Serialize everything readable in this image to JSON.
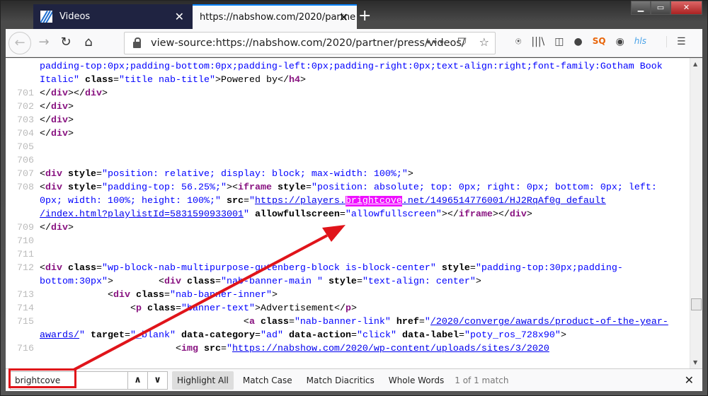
{
  "tabs": [
    {
      "title": "Videos",
      "close": "✕"
    },
    {
      "title": "https://nabshow.com/2020/partne",
      "close": "✕"
    }
  ],
  "new_tab": "+",
  "window": {
    "minimize": "▁",
    "maximize": "▭",
    "close": "✕"
  },
  "nav": {
    "back": "←",
    "forward": "→",
    "reload": "↻",
    "home": "⌂",
    "url": "view-source:https://nabshow.com/2020/partner/press/videos/",
    "more": "•••",
    "pocket": "⛉",
    "bookmark": "☆"
  },
  "toolbar_icons": [
    "bookmark-toolbar-icon",
    "library-icon",
    "sidebar-icon",
    "extension-icon",
    "sq-extension-icon",
    "account-icon",
    "hls-extension-icon",
    "menu-icon"
  ],
  "toolbar_glyphs": [
    "⍟",
    "|||\\",
    "◫",
    "●",
    "SQ",
    "◉",
    "hls",
    "☰"
  ],
  "code": [
    {
      "n": "",
      "tokens": [
        [
          "v",
          "padding-top:0px;padding-bottom:0px;padding-left:0px;padding-right:0px;text-align:right;font-family:Gotham Book"
        ]
      ]
    },
    {
      "n": "",
      "tokens": [
        [
          "v",
          "Italic\""
        ],
        [
          "x",
          " "
        ],
        [
          "a",
          "class"
        ],
        [
          "x",
          "="
        ],
        [
          "v",
          "\"title nab-title\""
        ],
        [
          "x",
          ">Powered by</"
        ],
        [
          "t",
          "h4"
        ],
        [
          "x",
          ">"
        ]
      ]
    },
    {
      "n": "701",
      "tokens": [
        [
          "x",
          "</"
        ],
        [
          "t",
          "div"
        ],
        [
          "x",
          "></"
        ],
        [
          "t",
          "div"
        ],
        [
          "x",
          ">"
        ]
      ]
    },
    {
      "n": "702",
      "tokens": [
        [
          "x",
          "</"
        ],
        [
          "t",
          "div"
        ],
        [
          "x",
          ">"
        ]
      ]
    },
    {
      "n": "703",
      "tokens": [
        [
          "x",
          "</"
        ],
        [
          "t",
          "div"
        ],
        [
          "x",
          ">"
        ]
      ]
    },
    {
      "n": "704",
      "tokens": [
        [
          "x",
          "</"
        ],
        [
          "t",
          "div"
        ],
        [
          "x",
          ">"
        ]
      ]
    },
    {
      "n": "705",
      "tokens": []
    },
    {
      "n": "706",
      "tokens": []
    },
    {
      "n": "707",
      "tokens": [
        [
          "x",
          "<"
        ],
        [
          "t",
          "div"
        ],
        [
          "x",
          " "
        ],
        [
          "a",
          "style"
        ],
        [
          "x",
          "="
        ],
        [
          "v",
          "\"position: relative; display: block; max-width: 100%;\""
        ],
        [
          "x",
          ">"
        ]
      ]
    },
    {
      "n": "708",
      "tokens": [
        [
          "x",
          "<"
        ],
        [
          "t",
          "div"
        ],
        [
          "x",
          " "
        ],
        [
          "a",
          "style"
        ],
        [
          "x",
          "="
        ],
        [
          "v",
          "\"padding-top: 56.25%;\""
        ],
        [
          "x",
          "><"
        ],
        [
          "t",
          "iframe"
        ],
        [
          "x",
          " "
        ],
        [
          "a",
          "style"
        ],
        [
          "x",
          "="
        ],
        [
          "v",
          "\"position: absolute; top: 0px; right: 0px; bottom: 0px; left:"
        ]
      ]
    },
    {
      "n": "",
      "tokens": [
        [
          "v",
          "0px; width: 100%; height: 100%;\""
        ],
        [
          "x",
          " "
        ],
        [
          "a",
          "src"
        ],
        [
          "x",
          "="
        ],
        [
          "v",
          "\""
        ],
        [
          "u",
          "https://players."
        ],
        [
          "h",
          "brightcove"
        ],
        [
          "u",
          ".net/1496514776001/HJ2RqAf0g_default"
        ]
      ]
    },
    {
      "n": "",
      "tokens": [
        [
          "u",
          "/index.html?playlistId=5831590933001"
        ],
        [
          "v",
          "\""
        ],
        [
          "x",
          " "
        ],
        [
          "a",
          "allowfullscreen"
        ],
        [
          "x",
          "="
        ],
        [
          "v",
          "\"allowfullscreen\""
        ],
        [
          "x",
          "></"
        ],
        [
          "t",
          "iframe"
        ],
        [
          "x",
          "></"
        ],
        [
          "t",
          "div"
        ],
        [
          "x",
          ">"
        ]
      ]
    },
    {
      "n": "709",
      "tokens": [
        [
          "x",
          "</"
        ],
        [
          "t",
          "div"
        ],
        [
          "x",
          ">"
        ]
      ]
    },
    {
      "n": "710",
      "tokens": []
    },
    {
      "n": "711",
      "tokens": []
    },
    {
      "n": "712",
      "tokens": [
        [
          "x",
          "<"
        ],
        [
          "t",
          "div"
        ],
        [
          "x",
          " "
        ],
        [
          "a",
          "class"
        ],
        [
          "x",
          "="
        ],
        [
          "v",
          "\"wp-block-nab-multipurpose-gutenberg-block is-block-center\""
        ],
        [
          "x",
          " "
        ],
        [
          "a",
          "style"
        ],
        [
          "x",
          "="
        ],
        [
          "v",
          "\"padding-top:30px;padding-"
        ]
      ]
    },
    {
      "n": "",
      "tokens": [
        [
          "v",
          "bottom:30px\""
        ],
        [
          "x",
          ">        <"
        ],
        [
          "t",
          "div"
        ],
        [
          "x",
          " "
        ],
        [
          "a",
          "class"
        ],
        [
          "x",
          "="
        ],
        [
          "v",
          "\"nab-banner-main \""
        ],
        [
          "x",
          " "
        ],
        [
          "a",
          "style"
        ],
        [
          "x",
          "="
        ],
        [
          "v",
          "\"text-align: center\""
        ],
        [
          "x",
          ">"
        ]
      ]
    },
    {
      "n": "713",
      "tokens": [
        [
          "x",
          "            <"
        ],
        [
          "t",
          "div"
        ],
        [
          "x",
          " "
        ],
        [
          "a",
          "class"
        ],
        [
          "x",
          "="
        ],
        [
          "v",
          "\"nab-banner-inner\""
        ],
        [
          "x",
          ">"
        ]
      ]
    },
    {
      "n": "714",
      "tokens": [
        [
          "x",
          "                <"
        ],
        [
          "t",
          "p"
        ],
        [
          "x",
          " "
        ],
        [
          "a",
          "class"
        ],
        [
          "x",
          "="
        ],
        [
          "v",
          "\"banner-text\""
        ],
        [
          "x",
          ">Advertisement</"
        ],
        [
          "t",
          "p"
        ],
        [
          "x",
          ">"
        ]
      ]
    },
    {
      "n": "715",
      "tokens": [
        [
          "x",
          "                                    <"
        ],
        [
          "t",
          "a"
        ],
        [
          "x",
          " "
        ],
        [
          "a",
          "class"
        ],
        [
          "x",
          "="
        ],
        [
          "v",
          "\"nab-banner-link\""
        ],
        [
          "x",
          " "
        ],
        [
          "a",
          "href"
        ],
        [
          "x",
          "="
        ],
        [
          "v",
          "\""
        ],
        [
          "u",
          "/2020/converge/awards/product-of-the-year-"
        ]
      ]
    },
    {
      "n": "",
      "tokens": [
        [
          "u",
          "awards/"
        ],
        [
          "v",
          "\""
        ],
        [
          "x",
          " "
        ],
        [
          "a",
          "target"
        ],
        [
          "x",
          "="
        ],
        [
          "v",
          "\"_blank\""
        ],
        [
          "x",
          " "
        ],
        [
          "a",
          "data-category"
        ],
        [
          "x",
          "="
        ],
        [
          "v",
          "\"ad\""
        ],
        [
          "x",
          " "
        ],
        [
          "a",
          "data-action"
        ],
        [
          "x",
          "="
        ],
        [
          "v",
          "\"click\""
        ],
        [
          "x",
          " "
        ],
        [
          "a",
          "data-label"
        ],
        [
          "x",
          "="
        ],
        [
          "v",
          "\"poty_ros_728x90\""
        ],
        [
          "x",
          ">"
        ]
      ]
    },
    {
      "n": "716",
      "tokens": [
        [
          "x",
          "                        <"
        ],
        [
          "t",
          "img"
        ],
        [
          "x",
          " "
        ],
        [
          "a",
          "src"
        ],
        [
          "x",
          "="
        ],
        [
          "v",
          "\""
        ],
        [
          "u",
          "https://nabshow.com/2020/wp-content/uploads/sites/3/2020"
        ]
      ]
    }
  ],
  "find": {
    "query": "brightcove",
    "prev": "∧",
    "next": "∨",
    "highlight_all": "Highlight All",
    "match_case": "Match Case",
    "match_diacritics": "Match Diacritics",
    "whole_words": "Whole Words",
    "status": "1 of 1 match",
    "close": "✕"
  },
  "colors": {
    "highlight": "#ef0fff",
    "annotation": "#e0141a",
    "accent": "#0a84ff"
  }
}
